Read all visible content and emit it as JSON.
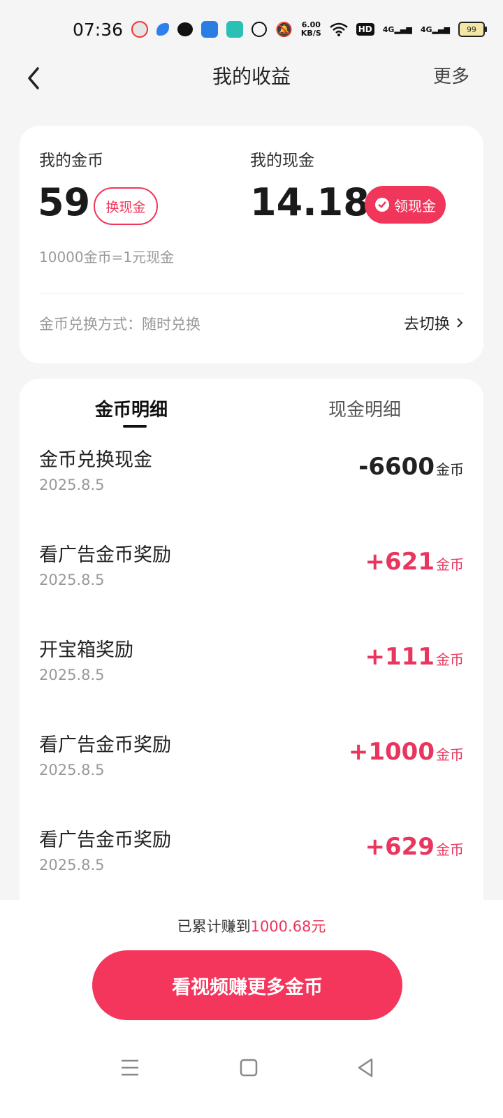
{
  "status": {
    "time": "07:36",
    "net_speed_top": "6.00",
    "net_speed_bottom": "KB/S",
    "hd": "HD",
    "sig1": "4G",
    "sig2": "4G",
    "battery": "99"
  },
  "header": {
    "title": "我的收益",
    "more": "更多"
  },
  "balance": {
    "coins_label": "我的金币",
    "coins_value": "59",
    "exchange_button": "换现金",
    "cash_label": "我的现金",
    "cash_value": "14.18",
    "withdraw_button": "领现金",
    "rate": "10000金币=1元现金",
    "method": "金币兑换方式：随时兑换",
    "switch": "去切换"
  },
  "tabs": {
    "coin_detail": "金币明细",
    "cash_detail": "现金明细"
  },
  "records": [
    {
      "title": "金币兑换现金",
      "date": "2025.8.5",
      "amount": "-6600",
      "unit": "金币",
      "sign": "neg"
    },
    {
      "title": "看广告金币奖励",
      "date": "2025.8.5",
      "amount": "+621",
      "unit": "金币",
      "sign": "pos"
    },
    {
      "title": "开宝箱奖励",
      "date": "2025.8.5",
      "amount": "+111",
      "unit": "金币",
      "sign": "pos"
    },
    {
      "title": "看广告金币奖励",
      "date": "2025.8.5",
      "amount": "+1000",
      "unit": "金币",
      "sign": "pos"
    },
    {
      "title": "看广告金币奖励",
      "date": "2025.8.5",
      "amount": "+629",
      "unit": "金币",
      "sign": "pos"
    }
  ],
  "footer": {
    "total_prefix": "已累计赚到",
    "total_value": "1000.68元",
    "cta": "看视频赚更多金币"
  },
  "colors": {
    "accent": "#f0365a",
    "text": "#222222",
    "muted": "#999999"
  }
}
